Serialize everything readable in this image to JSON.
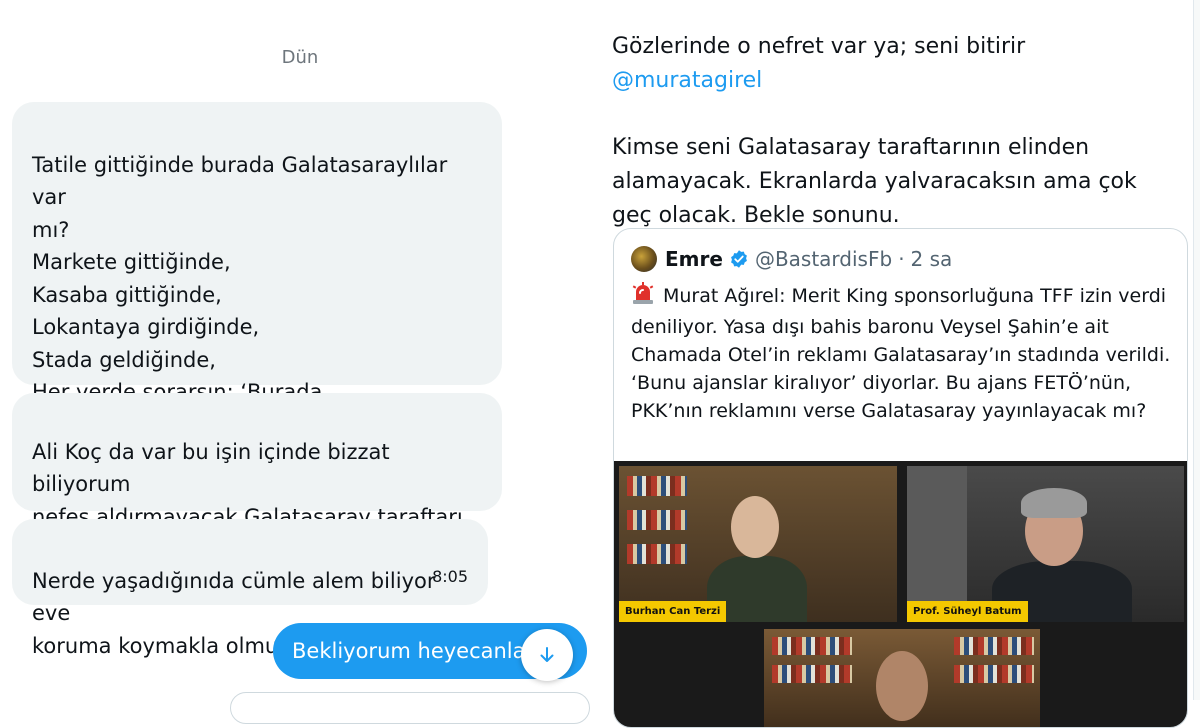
{
  "conversation": {
    "date_separator": "Dün",
    "messages": [
      {
        "text": "Tatile gittiğinde burada Galatasaraylılar var\nmı?\nMarkete gittiğinde,\nKasaba gittiğinde,\nLokantaya girdiğinde,\nStada geldiğinde,\nHer yerde sorarsın: ‘Burada Galatasaraylılar\nvar mı ?"
      },
      {
        "text": "Ali Koç da var bu işin içinde bizzat biliyorum\nnefes aldırmayacak Galatasaray taraftarı.\nAlgıcı p... Venkler"
      },
      {
        "text": "Nerde yaşadığınıda cümle alem biliyor eve\nkoruma koymakla olmuyor o işler",
        "time": "8:05"
      }
    ],
    "sent_message": {
      "text": "Bekliyorum heyecanla"
    },
    "scroll_button_icon": "arrow-down-icon"
  },
  "tweet": {
    "line1_text": "Gözlerinde o nefret var ya; seni bitirir ",
    "mention": "@muratagirel",
    "paragraph2": "Kimse seni Galatasaray taraftarının elinden alamayacak. Ekranlarda yalvaracaksın ama çok geç olacak. Bekle sonunu.",
    "quote": {
      "author_name": "Emre",
      "verified_icon": "verified-badge-icon",
      "handle": "@BastardisFb",
      "separator": "·",
      "time": "2 sa",
      "siren_icon": "siren-icon",
      "text": "Murat Ağırel: Merit King sponsorluğuna TFF izin verdi deniliyor. Yasa dışı bahis baronu Veysel Şahin’e ait Chamada Otel’in reklamı Galatasaray’ın stadında verildi. ‘Bunu ajanslar kiralıyor’ diyorlar. Bu ajans FETÖ’nün, PKK’nın reklamını verse Galatasaray yayınlayacak mı?",
      "media": {
        "participants": [
          {
            "name": "Burhan Can Terzi"
          },
          {
            "name": "Prof. Süheyl Batum"
          }
        ]
      }
    }
  },
  "colors": {
    "accent": "#1d9bf0",
    "bubble_received": "#eff3f4",
    "name_tag": "#f4c800"
  }
}
